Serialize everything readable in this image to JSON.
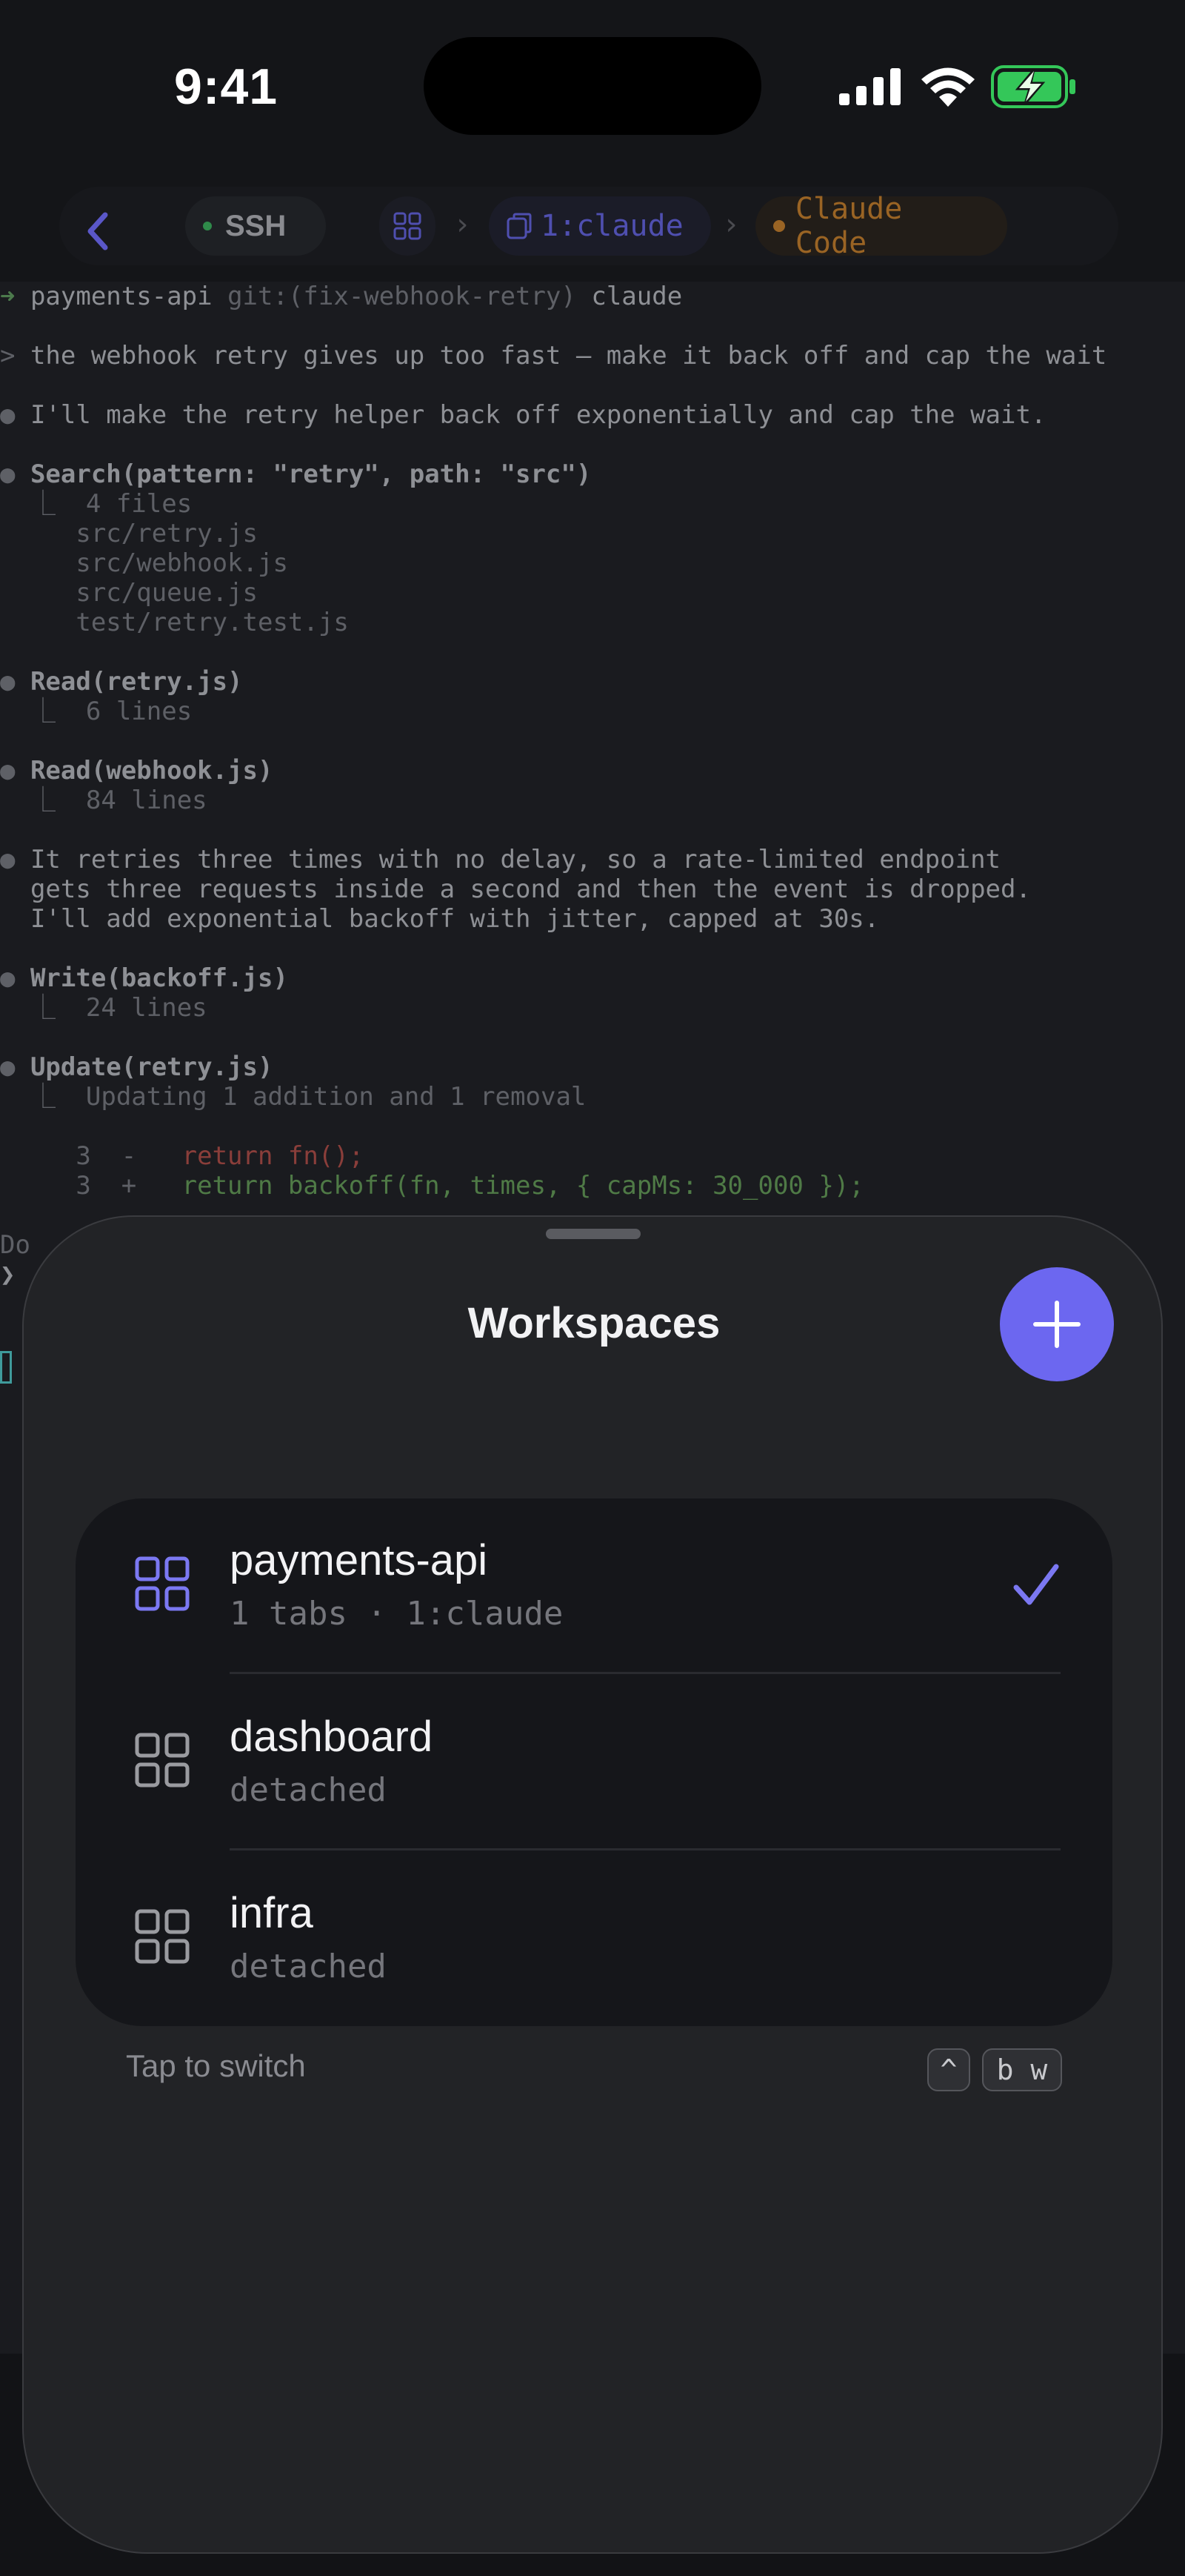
{
  "status": {
    "time": "9:41"
  },
  "toolbar": {
    "connection": "SSH",
    "tab": "1:claude",
    "process": "Claude Code"
  },
  "terminal": {
    "lines": [
      {
        "segs": [
          {
            "t": "➜ ",
            "c": "c-green"
          },
          {
            "t": "payments-api ",
            "c": "c-text"
          },
          {
            "t": "git:(fix-webhook-retry) ",
            "c": "c-dim"
          },
          {
            "t": "claude",
            "c": "c-text"
          }
        ]
      },
      {
        "segs": [
          {
            "t": "> ",
            "c": "c-dim"
          },
          {
            "t": "the webhook retry gives up too fast — make it back off and cap the wait",
            "c": "c-text"
          }
        ]
      },
      {
        "segs": [
          {
            "t": "● ",
            "c": "c-dim"
          },
          {
            "t": "I'll make the retry helper back off exponentially and cap the wait.",
            "c": "c-text"
          }
        ]
      },
      {
        "segs": [
          {
            "t": "● ",
            "c": "c-dim"
          },
          {
            "t": "Search(pattern: \"retry\", path: \"src\")",
            "c": "c-bold"
          }
        ]
      },
      {
        "segs": [
          {
            "t": "  ⎿  4 files",
            "c": "c-dim"
          }
        ]
      },
      {
        "segs": [
          {
            "t": "     src/retry.js",
            "c": "c-dim"
          }
        ]
      },
      {
        "segs": [
          {
            "t": "     src/webhook.js",
            "c": "c-dim"
          }
        ]
      },
      {
        "segs": [
          {
            "t": "     src/queue.js",
            "c": "c-dim"
          }
        ]
      },
      {
        "segs": [
          {
            "t": "     test/retry.test.js",
            "c": "c-dim"
          }
        ]
      },
      {
        "segs": [
          {
            "t": "● ",
            "c": "c-dim"
          },
          {
            "t": "Read(retry.js)",
            "c": "c-bold"
          }
        ]
      },
      {
        "segs": [
          {
            "t": "  ⎿  6 lines",
            "c": "c-dim"
          }
        ]
      },
      {
        "segs": [
          {
            "t": "● ",
            "c": "c-dim"
          },
          {
            "t": "Read(webhook.js)",
            "c": "c-bold"
          }
        ]
      },
      {
        "segs": [
          {
            "t": "  ⎿  84 lines",
            "c": "c-dim"
          }
        ]
      },
      {
        "segs": [
          {
            "t": "● ",
            "c": "c-dim"
          },
          {
            "t": "It retries three times with no delay, so a rate-limited endpoint",
            "c": "c-text"
          }
        ]
      },
      {
        "segs": [
          {
            "t": "  gets three requests inside a second and then the event is dropped.",
            "c": "c-text"
          }
        ]
      },
      {
        "segs": [
          {
            "t": "  I'll add exponential backoff with jitter, capped at 30s.",
            "c": "c-text"
          }
        ]
      },
      {
        "segs": [
          {
            "t": "● ",
            "c": "c-dim"
          },
          {
            "t": "Write(backoff.js)",
            "c": "c-bold"
          }
        ]
      },
      {
        "segs": [
          {
            "t": "  ⎿  24 lines",
            "c": "c-dim"
          }
        ]
      },
      {
        "segs": [
          {
            "t": "● ",
            "c": "c-dim"
          },
          {
            "t": "Update(retry.js)",
            "c": "c-bold"
          }
        ]
      },
      {
        "segs": [
          {
            "t": "  ⎿  Updating 1 addition and 1 removal",
            "c": "c-dim"
          }
        ]
      },
      {
        "segs": [
          {
            "t": "     3  -   ",
            "c": "c-dim"
          },
          {
            "t": "return fn();",
            "c": "c-red"
          }
        ]
      },
      {
        "segs": [
          {
            "t": "     3  +   ",
            "c": "c-dim"
          },
          {
            "t": "return backoff(fn, times, { capMs: 30_000 });",
            "c": "c-addg"
          }
        ]
      },
      {
        "segs": [
          {
            "t": "Do",
            "c": "c-dim"
          }
        ]
      },
      {
        "segs": [
          {
            "t": "❯",
            "c": "c-text"
          }
        ]
      }
    ]
  },
  "sheet": {
    "title": "Workspaces",
    "workspaces": [
      {
        "name": "payments-api",
        "detail": "1 tabs · 1:claude",
        "active": true
      },
      {
        "name": "dashboard",
        "detail": "detached",
        "active": false
      },
      {
        "name": "infra",
        "detail": "detached",
        "active": false
      }
    ],
    "hint": "Tap to switch",
    "shortcut_mod": "^",
    "shortcut_keys": "b w"
  },
  "colors": {
    "accent": "#6c67f0",
    "active_icon": "#7b78f2",
    "inactive_icon": "#9a9ba0"
  }
}
